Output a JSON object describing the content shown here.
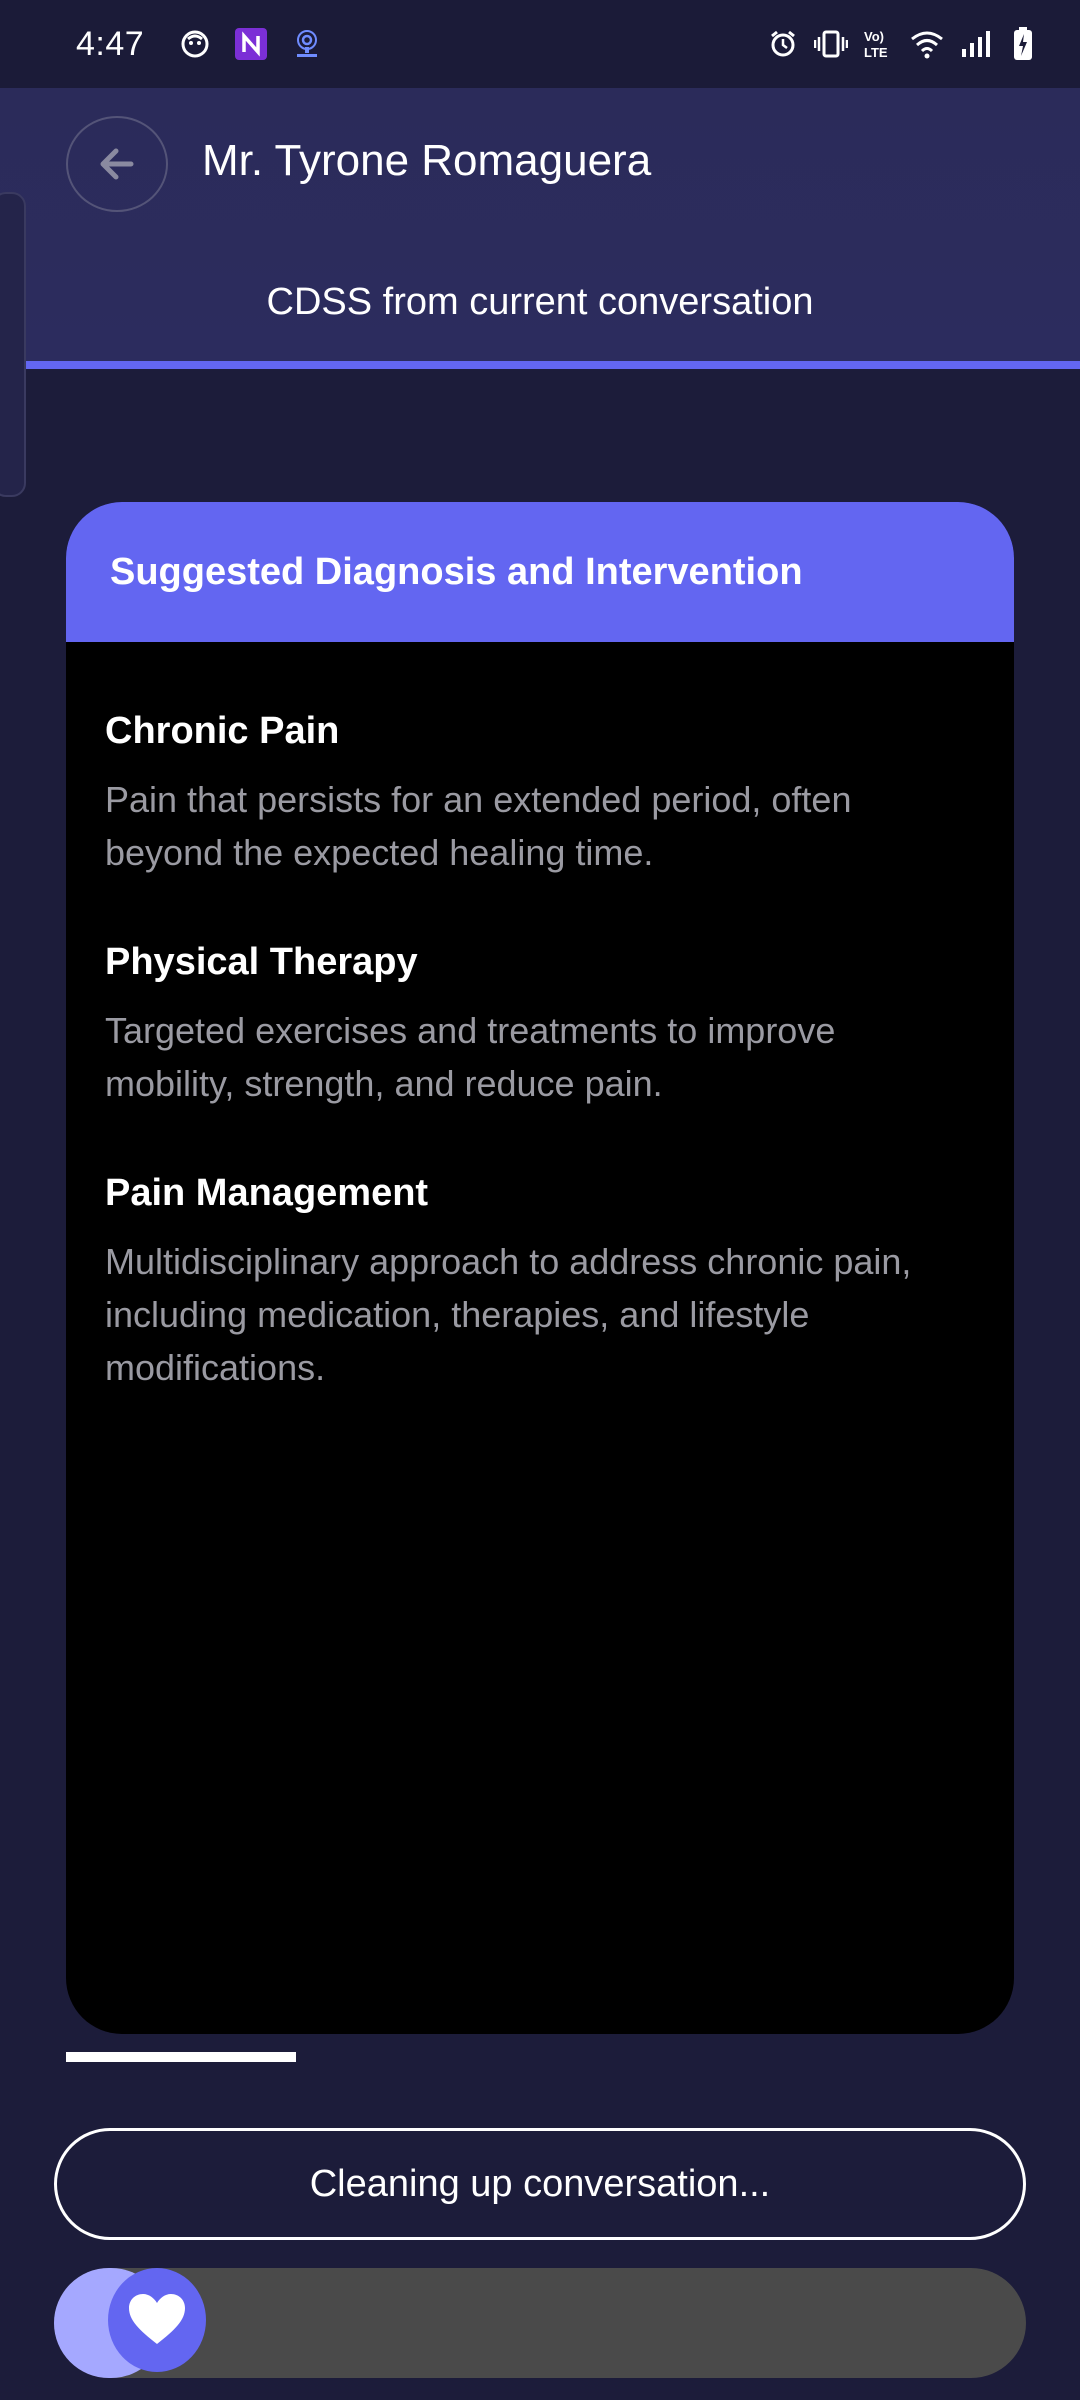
{
  "status_bar": {
    "time": "4:47",
    "left_icons": [
      "emoji-icon",
      "n-app-icon",
      "podcast-icon"
    ],
    "right_icons": [
      "alarm-icon",
      "vibrate-icon",
      "volte-icon",
      "wifi-icon",
      "signal-icon",
      "battery-charging-icon"
    ],
    "volte_text": "Vo) LTE"
  },
  "header": {
    "patient_name": "Mr. Tyrone Romaguera",
    "subtitle": "CDSS from current conversation"
  },
  "card": {
    "title": "Suggested Diagnosis and Intervention",
    "items": [
      {
        "title": "Chronic Pain",
        "description": "Pain that persists for an extended period, often beyond the expected healing time."
      },
      {
        "title": "Physical Therapy",
        "description": "Targeted exercises and treatments to improve mobility, strength, and reduce pain."
      },
      {
        "title": "Pain Management",
        "description": "Multidisciplinary approach to address chronic pain, including medication, therapies, and lifestyle modifications."
      }
    ]
  },
  "actions": {
    "cleaning_label": "Cleaning up conversation..."
  },
  "colors": {
    "accent": "#6366f1",
    "background": "#1c1c3a",
    "header": "#2c2c5e",
    "card": "#000000",
    "description_text": "#9a9aa2"
  }
}
